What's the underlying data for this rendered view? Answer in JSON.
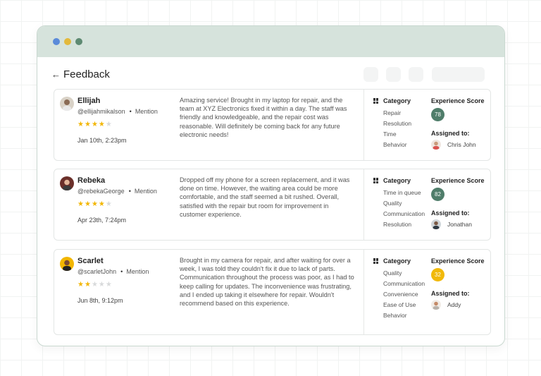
{
  "window": {
    "dots": [
      {
        "color": "#5b8bd9",
        "name": "window-dot-blue"
      },
      {
        "color": "#e3b93c",
        "name": "window-dot-yellow"
      },
      {
        "color": "#5e8a72",
        "name": "window-dot-green"
      }
    ]
  },
  "header": {
    "back_icon": "arrow-left-icon",
    "back_glyph": "←",
    "title": "Feedback"
  },
  "labels": {
    "category": "Category",
    "experience_score": "Experience Score",
    "assigned_to": "Assigned to:",
    "mention": "Mention"
  },
  "feedback": [
    {
      "name": "Ellijah",
      "handle": "@ellijahmikalson",
      "rating": 4,
      "max_rating": 5,
      "date": "Jan 10th, 2:23pm",
      "message": "Amazing service! Brought in my laptop for repair, and the team at XYZ Electronics fixed it within a day. The staff was friendly and knowledgeable, and the repair cost was reasonable. Will definitely be coming back for any future electronic needs!",
      "categories": [
        "Repair",
        "Resolution",
        "Time",
        "Behavior"
      ],
      "score": "78",
      "score_color": "#4f7d6a",
      "assignee": "Chris John"
    },
    {
      "name": "Rebeka",
      "handle": "@rebekaGeorge",
      "rating": 4,
      "max_rating": 5,
      "date": "Apr 23th, 7:24pm",
      "message": "Dropped off my phone for a screen replacement, and it was done on time. However, the waiting area could be more comfortable, and the staff seemed a bit rushed. Overall, satisfied with the repair but room for improvement in customer experience.",
      "categories": [
        "Time in queue",
        "Quality",
        "Communication",
        "Resolution"
      ],
      "score": "82",
      "score_color": "#4f7d6a",
      "assignee": "Jonathan"
    },
    {
      "name": "Scarlet",
      "handle": "@scarletJohn",
      "rating": 2,
      "max_rating": 5,
      "date": "Jun 8th, 9:12pm",
      "message": "Brought in my camera for repair, and after waiting for over a week, I was told they couldn't fix it due to lack of parts. Communication throughout the process was poor, as I had to keep calling for updates. The inconvenience was frustrating, and I ended up taking it elsewhere for repair. Wouldn't recommend based on this experience.",
      "categories": [
        "Quality",
        "Communication",
        "Convenience",
        "Ease of Use",
        "Behavior"
      ],
      "score": "32",
      "score_color": "#f1b90a",
      "assignee": "Addy"
    }
  ]
}
